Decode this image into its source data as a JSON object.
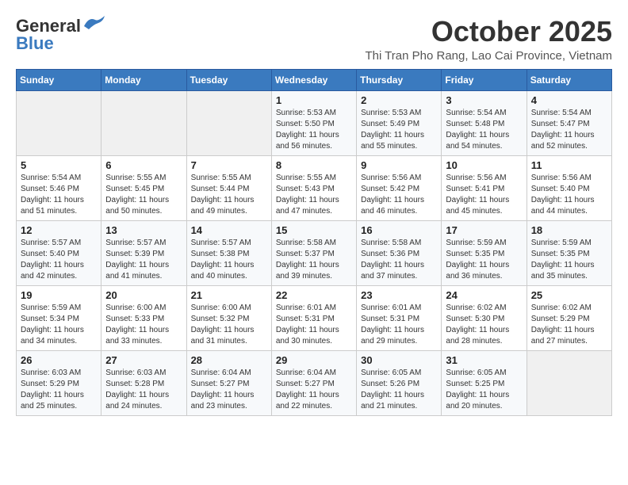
{
  "header": {
    "logo_general": "General",
    "logo_blue": "Blue",
    "month_year": "October 2025",
    "location": "Thi Tran Pho Rang, Lao Cai Province, Vietnam"
  },
  "weekdays": [
    "Sunday",
    "Monday",
    "Tuesday",
    "Wednesday",
    "Thursday",
    "Friday",
    "Saturday"
  ],
  "weeks": [
    [
      {
        "day": "",
        "info": ""
      },
      {
        "day": "",
        "info": ""
      },
      {
        "day": "",
        "info": ""
      },
      {
        "day": "1",
        "info": "Sunrise: 5:53 AM\nSunset: 5:50 PM\nDaylight: 11 hours\nand 56 minutes."
      },
      {
        "day": "2",
        "info": "Sunrise: 5:53 AM\nSunset: 5:49 PM\nDaylight: 11 hours\nand 55 minutes."
      },
      {
        "day": "3",
        "info": "Sunrise: 5:54 AM\nSunset: 5:48 PM\nDaylight: 11 hours\nand 54 minutes."
      },
      {
        "day": "4",
        "info": "Sunrise: 5:54 AM\nSunset: 5:47 PM\nDaylight: 11 hours\nand 52 minutes."
      }
    ],
    [
      {
        "day": "5",
        "info": "Sunrise: 5:54 AM\nSunset: 5:46 PM\nDaylight: 11 hours\nand 51 minutes."
      },
      {
        "day": "6",
        "info": "Sunrise: 5:55 AM\nSunset: 5:45 PM\nDaylight: 11 hours\nand 50 minutes."
      },
      {
        "day": "7",
        "info": "Sunrise: 5:55 AM\nSunset: 5:44 PM\nDaylight: 11 hours\nand 49 minutes."
      },
      {
        "day": "8",
        "info": "Sunrise: 5:55 AM\nSunset: 5:43 PM\nDaylight: 11 hours\nand 47 minutes."
      },
      {
        "day": "9",
        "info": "Sunrise: 5:56 AM\nSunset: 5:42 PM\nDaylight: 11 hours\nand 46 minutes."
      },
      {
        "day": "10",
        "info": "Sunrise: 5:56 AM\nSunset: 5:41 PM\nDaylight: 11 hours\nand 45 minutes."
      },
      {
        "day": "11",
        "info": "Sunrise: 5:56 AM\nSunset: 5:40 PM\nDaylight: 11 hours\nand 44 minutes."
      }
    ],
    [
      {
        "day": "12",
        "info": "Sunrise: 5:57 AM\nSunset: 5:40 PM\nDaylight: 11 hours\nand 42 minutes."
      },
      {
        "day": "13",
        "info": "Sunrise: 5:57 AM\nSunset: 5:39 PM\nDaylight: 11 hours\nand 41 minutes."
      },
      {
        "day": "14",
        "info": "Sunrise: 5:57 AM\nSunset: 5:38 PM\nDaylight: 11 hours\nand 40 minutes."
      },
      {
        "day": "15",
        "info": "Sunrise: 5:58 AM\nSunset: 5:37 PM\nDaylight: 11 hours\nand 39 minutes."
      },
      {
        "day": "16",
        "info": "Sunrise: 5:58 AM\nSunset: 5:36 PM\nDaylight: 11 hours\nand 37 minutes."
      },
      {
        "day": "17",
        "info": "Sunrise: 5:59 AM\nSunset: 5:35 PM\nDaylight: 11 hours\nand 36 minutes."
      },
      {
        "day": "18",
        "info": "Sunrise: 5:59 AM\nSunset: 5:35 PM\nDaylight: 11 hours\nand 35 minutes."
      }
    ],
    [
      {
        "day": "19",
        "info": "Sunrise: 5:59 AM\nSunset: 5:34 PM\nDaylight: 11 hours\nand 34 minutes."
      },
      {
        "day": "20",
        "info": "Sunrise: 6:00 AM\nSunset: 5:33 PM\nDaylight: 11 hours\nand 33 minutes."
      },
      {
        "day": "21",
        "info": "Sunrise: 6:00 AM\nSunset: 5:32 PM\nDaylight: 11 hours\nand 31 minutes."
      },
      {
        "day": "22",
        "info": "Sunrise: 6:01 AM\nSunset: 5:31 PM\nDaylight: 11 hours\nand 30 minutes."
      },
      {
        "day": "23",
        "info": "Sunrise: 6:01 AM\nSunset: 5:31 PM\nDaylight: 11 hours\nand 29 minutes."
      },
      {
        "day": "24",
        "info": "Sunrise: 6:02 AM\nSunset: 5:30 PM\nDaylight: 11 hours\nand 28 minutes."
      },
      {
        "day": "25",
        "info": "Sunrise: 6:02 AM\nSunset: 5:29 PM\nDaylight: 11 hours\nand 27 minutes."
      }
    ],
    [
      {
        "day": "26",
        "info": "Sunrise: 6:03 AM\nSunset: 5:29 PM\nDaylight: 11 hours\nand 25 minutes."
      },
      {
        "day": "27",
        "info": "Sunrise: 6:03 AM\nSunset: 5:28 PM\nDaylight: 11 hours\nand 24 minutes."
      },
      {
        "day": "28",
        "info": "Sunrise: 6:04 AM\nSunset: 5:27 PM\nDaylight: 11 hours\nand 23 minutes."
      },
      {
        "day": "29",
        "info": "Sunrise: 6:04 AM\nSunset: 5:27 PM\nDaylight: 11 hours\nand 22 minutes."
      },
      {
        "day": "30",
        "info": "Sunrise: 6:05 AM\nSunset: 5:26 PM\nDaylight: 11 hours\nand 21 minutes."
      },
      {
        "day": "31",
        "info": "Sunrise: 6:05 AM\nSunset: 5:25 PM\nDaylight: 11 hours\nand 20 minutes."
      },
      {
        "day": "",
        "info": ""
      }
    ]
  ]
}
